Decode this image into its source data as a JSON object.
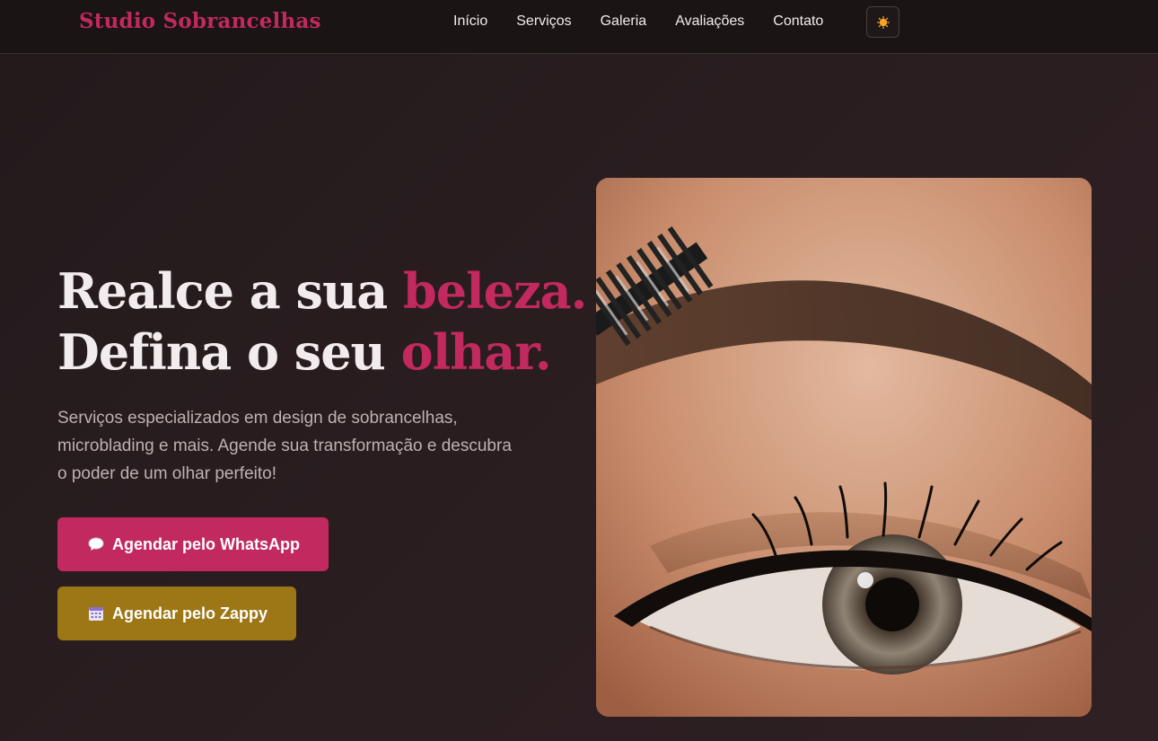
{
  "header": {
    "brand": "Studio Sobrancelhas",
    "nav": [
      "Início",
      "Serviços",
      "Galeria",
      "Avaliações",
      "Contato"
    ],
    "theme_toggle_icon": "sun-icon"
  },
  "hero": {
    "title_line1_plain": "Realce a sua ",
    "title_line1_accent": "beleza.",
    "title_line2_plain": "Defina o seu ",
    "title_line2_accent": "olhar.",
    "description": "Serviços especializados em design de sobrancelhas, microblading e mais. Agende sua transformação e descubra o poder de um olhar perfeito!",
    "buttons": [
      {
        "label": "Agendar pelo WhatsApp",
        "icon": "speech-bubble-icon"
      },
      {
        "label": "Agendar pelo Zappy",
        "icon": "calendar-icon"
      }
    ],
    "image_icon": "eyebrow-eye-photo"
  },
  "colors": {
    "accent": "#c2295f",
    "gold": "#9d7615",
    "background": "#2b1e21",
    "header": "#1a1415"
  }
}
